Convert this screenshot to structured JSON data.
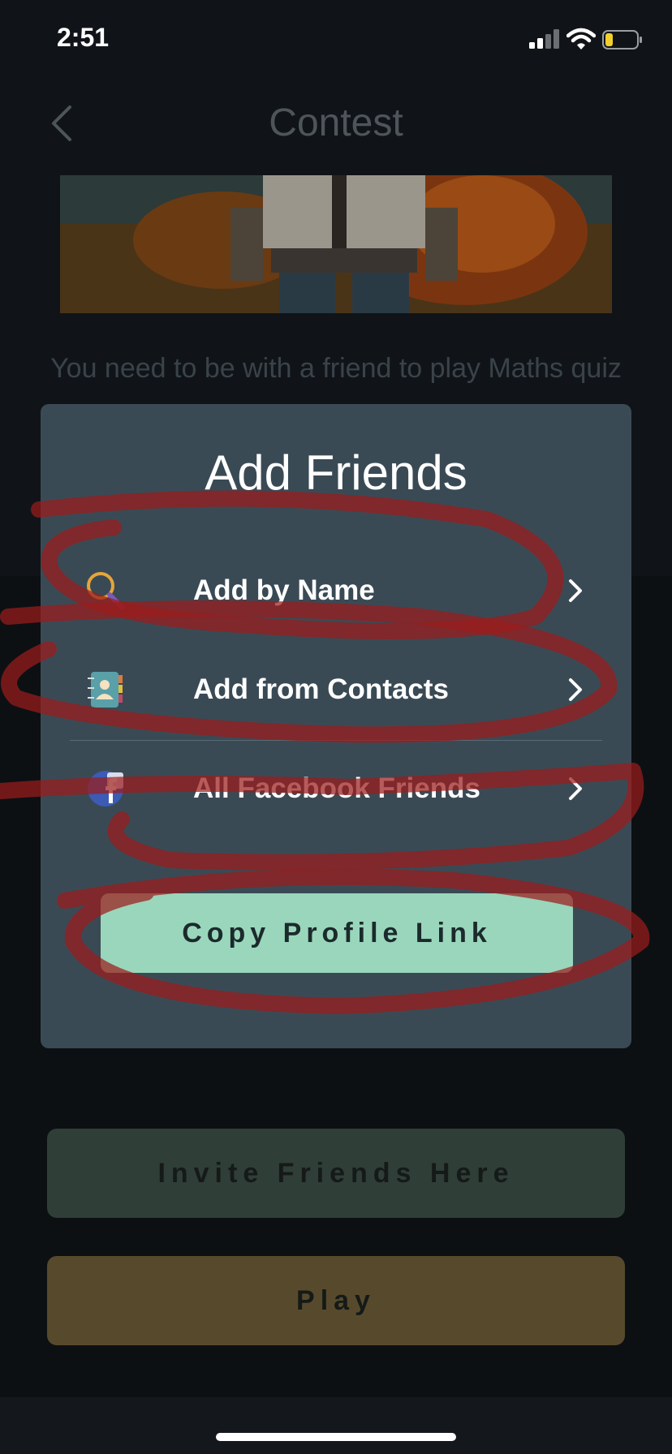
{
  "status_bar": {
    "time": "2:51"
  },
  "nav": {
    "title": "Contest"
  },
  "background": {
    "prompt_text": "You need to be with a friend to play Maths quiz",
    "invite_label": "Invite Friends Here",
    "play_label": "Play"
  },
  "modal": {
    "title": "Add Friends",
    "options": [
      {
        "label": "Add by Name",
        "icon": "search-icon"
      },
      {
        "label": "Add from Contacts",
        "icon": "contacts-book-icon"
      },
      {
        "label": "All Facebook Friends",
        "icon": "facebook-icon"
      }
    ],
    "copy_label": "Copy Profile Link"
  },
  "colors": {
    "modal_bg": "#3a4a55",
    "copy_button": "#9ad6bb",
    "invite_button": "#2f3e37",
    "play_button": "#574a2c",
    "annotation_red": "#9b1c1c"
  }
}
